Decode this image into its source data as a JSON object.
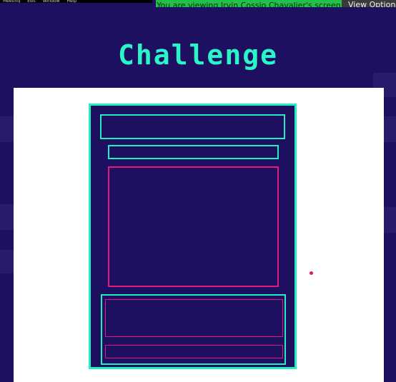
{
  "menu": {
    "items": [
      "Meeting",
      "Edit",
      "Window",
      "Help"
    ]
  },
  "banner": {
    "text": "You are viewing Irvin Cossio Chavalier's screen"
  },
  "view_options": {
    "label": "View Options"
  },
  "heading": {
    "title": "Challenge"
  },
  "colors": {
    "background": "#1e1060",
    "accent_teal": "#1ef0c0",
    "accent_pink": "#e4197c",
    "banner_green": "#20c04a"
  }
}
